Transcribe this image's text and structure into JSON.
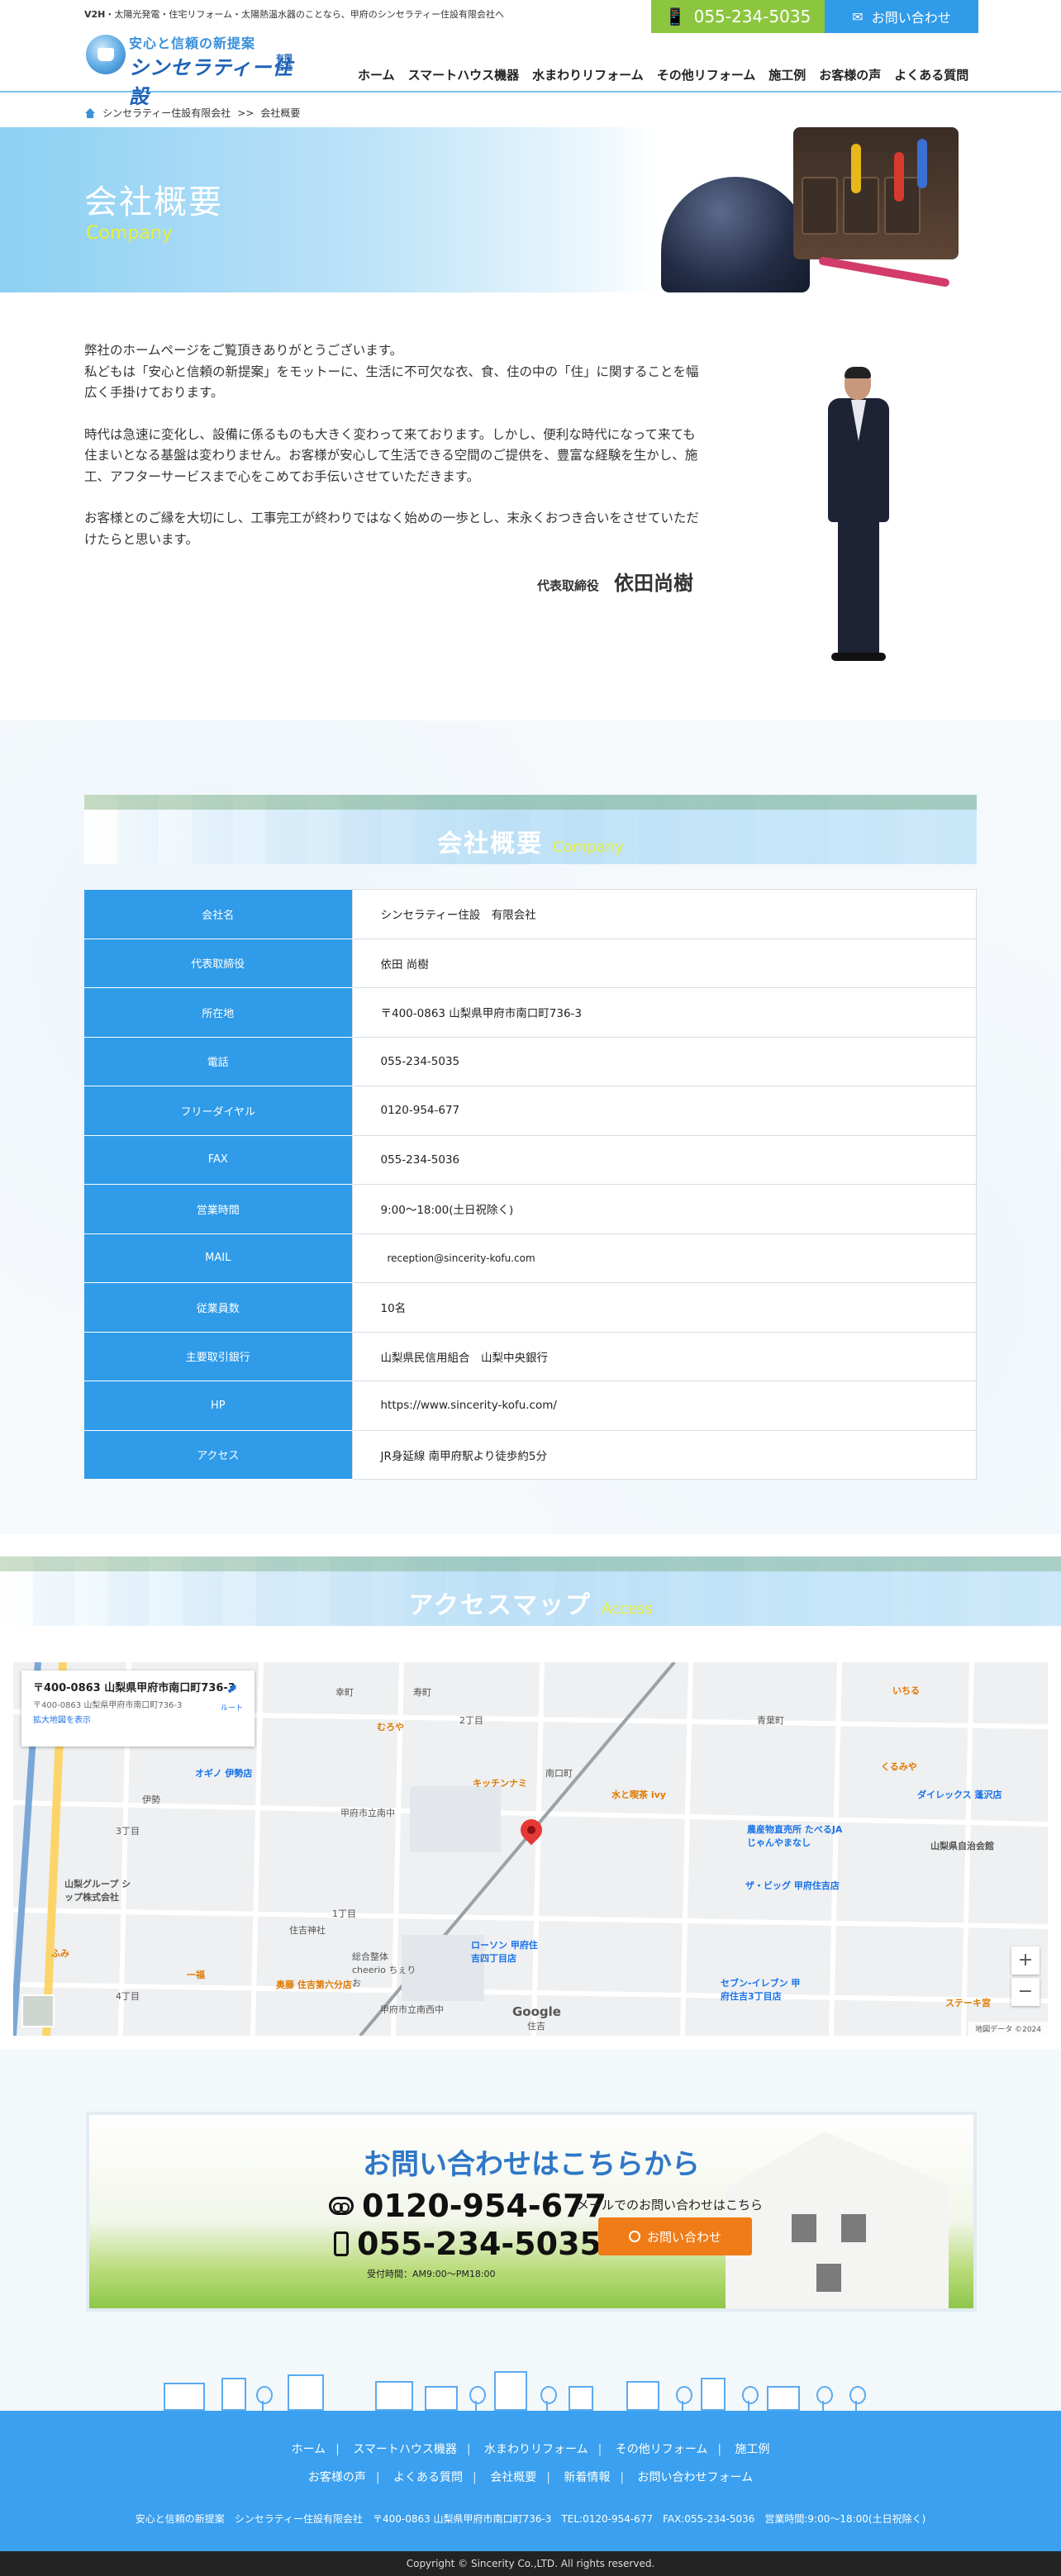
{
  "header": {
    "tagline_bold": "V2H",
    "tagline_rest": "・太陽光発電・住宅リフォーム・太陽熱温水器のことなら、甲府のシンセラティー住設有限会社へ",
    "logo_slogan": "安心と信頼の新提案",
    "logo_name": "シンセラティー住設",
    "logo_sub": "有限会社",
    "tel": "055-234-5035",
    "contact_label": "お問い合わせ",
    "nav": [
      "ホーム",
      "スマートハウス機器",
      "水まわりリフォーム",
      "その他リフォーム",
      "施工例",
      "お客様の声",
      "よくある質問"
    ]
  },
  "breadcrumb": {
    "home": "シンセラティー住設有限会社",
    "separator": ">>",
    "current": "会社概要"
  },
  "hero": {
    "title": "会社概要",
    "subtitle": "Company"
  },
  "greeting": {
    "paragraphs": [
      "弊社のホームページをご覧頂きありがとうございます。\n私どもは「安心と信頼の新提案」をモットーに、生活に不可欠な衣、食、住の中の「住」に関することを幅広く手掛けております。",
      "時代は急速に変化し、設備に係るものも大きく変わって来ております。しかし、便利な時代になって来ても住まいとなる基盤は変わりません。お客様が安心して生活できる空間のご提供を、豊富な経験を生かし、施工、アフターサービスまで心をこめてお手伝いさせていただきます。",
      "お客様とのご縁を大切にし、工事完工が終わりではなく始めの一歩とし、末永くおつき合いをさせていただけたらと思います。"
    ],
    "sig_role": "代表取締役",
    "sig_name": "依田尚樹"
  },
  "company": {
    "title": "会社概要",
    "title_en": "Company",
    "rows": [
      {
        "label": "会社名",
        "value": "シンセラティー住設　有限会社"
      },
      {
        "label": "代表取締役",
        "value": "依田 尚樹"
      },
      {
        "label": "所在地",
        "value": "〒400-0863 山梨県甲府市南口町736-3"
      },
      {
        "label": "電話",
        "value": "055-234-5035"
      },
      {
        "label": "フリーダイヤル",
        "value": "0120-954-677"
      },
      {
        "label": "FAX",
        "value": "055-234-5036"
      },
      {
        "label": "営業時間",
        "value": "9:00～18:00(土日祝除く)"
      },
      {
        "label": "MAIL",
        "value": "reception@sincerity-kofu.com"
      },
      {
        "label": "従業員数",
        "value": "10名"
      },
      {
        "label": "主要取引銀行",
        "value": "山梨県民信用組合　山梨中央銀行"
      },
      {
        "label": "HP",
        "value": "https://www.sincerity-kofu.com/"
      },
      {
        "label": "アクセス",
        "value": "JR身延線 南甲府駅より徒歩約5分"
      }
    ]
  },
  "access": {
    "title": "アクセスマップ",
    "title_en": "Access"
  },
  "map": {
    "card_title": "〒400-0863 山梨県甲府市南口町736-3",
    "card_addr": "〒400-0863 山梨県甲府市南口町736-3",
    "card_link": "拡大地図を表示",
    "route": "ルート",
    "labels": [
      "幸町",
      "寿町",
      "2丁目",
      "青葉町",
      "南口町",
      "伊勢",
      "3丁目",
      "1丁目",
      "4丁目",
      "住吉",
      "甲府市立南中",
      "住吉神社",
      "総合整体 cheerio ちぇりお",
      "甲府市立南西中"
    ],
    "pois": [
      "キッチンナミ",
      "水と喫茶 ivy",
      "農産物直売所 たべるJAじゃんやまなし",
      "ザ・ビッグ 甲府住吉店",
      "ローソン 甲府住吉四丁目店",
      "セブン-イレブン 甲府住吉3丁目店",
      "ダイレックス 蓬沢店",
      "山梨県自治会館",
      "オギノ 伊勢店",
      "山梨グループ シップ株式会社",
      "むろや",
      "くるみや",
      "いちる",
      "ステーキ宮",
      "ふみ",
      "一福",
      "奥藤 住吉第六分店"
    ],
    "copyright": "地図データ ©2024"
  },
  "contact": {
    "title": "お問い合わせはこちらから",
    "freedial": "0120-954-677",
    "tel": "055-234-5035",
    "hours": "受付時間：AM9:00～PM18:00",
    "mail_note": "メールでのお問い合わせはこちら",
    "button": "お問い合わせ"
  },
  "footer": {
    "nav_row1": [
      "ホーム",
      "スマートハウス機器",
      "水まわりリフォーム",
      "その他リフォーム",
      "施工例"
    ],
    "nav_row2": [
      "お客様の声",
      "よくある質問",
      "会社概要",
      "新着情報",
      "お問い合わせフォーム"
    ],
    "address": "安心と信頼の新提案　シンセラティー住設有限会社　〒400-0863 山梨県甲府市南口町736-3　TEL:0120-954-677　FAX:055-234-5036　営業時間:9:00～18:00(土日祝除く)",
    "copyright": "Copyright © Sincerity Co.,LTD. All rights reserved."
  },
  "colors": {
    "accent_blue": "#2f9be9",
    "tel_green": "#8cc63f",
    "button_orange": "#f07c17",
    "subtitle_yellow": "#e5ee3a"
  }
}
